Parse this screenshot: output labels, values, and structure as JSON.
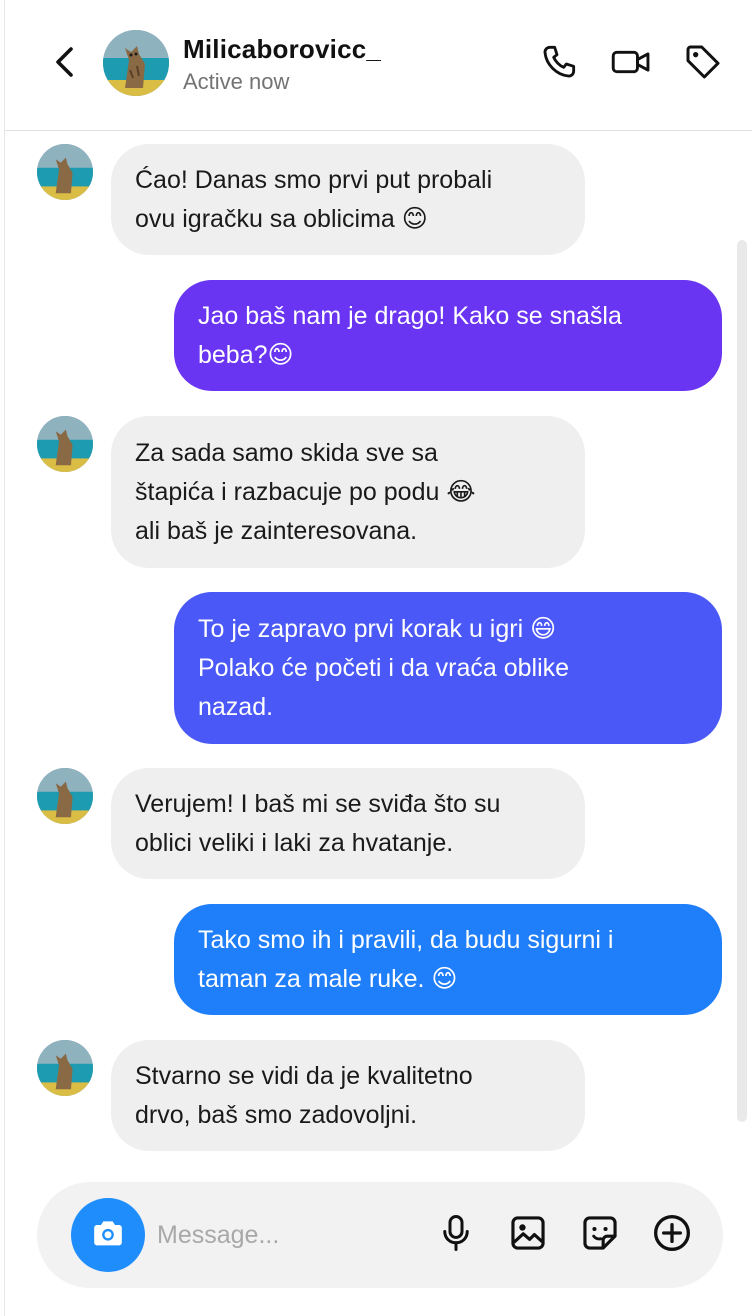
{
  "header": {
    "contact_name": "Milicaborovicc_",
    "status": "Active now"
  },
  "icons": {
    "back": "chevron-left-icon",
    "call": "phone-icon",
    "video": "video-camera-icon",
    "tag": "tag-icon",
    "camera": "camera-icon",
    "mic": "microphone-icon",
    "gallery": "image-icon",
    "sticker": "sticker-icon",
    "add": "plus-circle-icon"
  },
  "colors": {
    "incoming_bubble": "#efefef",
    "outgoing_1": "#6a35f2",
    "outgoing_2": "#4a58f7",
    "outgoing_3": "#1f7ef9",
    "camera_button": "#1f8efc"
  },
  "messages": [
    {
      "direction": "incoming",
      "lines": [
        "Ćao! Danas smo prvi put probali",
        "ovu igračku sa oblicima 😊"
      ]
    },
    {
      "direction": "outgoing",
      "lines": [
        "Jao baš nam je drago! Kako se snašla",
        "beba?😊"
      ]
    },
    {
      "direction": "incoming",
      "lines": [
        "Za sada samo skida sve sa",
        "štapića i razbacuje po podu 😂",
        "ali baš je zainteresovana."
      ]
    },
    {
      "direction": "outgoing",
      "lines": [
        "To je zapravo prvi korak u igri 😄",
        "Polako će početi i da vraća oblike",
        "nazad."
      ]
    },
    {
      "direction": "incoming",
      "lines": [
        "Verujem! I baš mi se sviđa što su",
        "oblici veliki i laki za hvatanje."
      ]
    },
    {
      "direction": "outgoing",
      "lines": [
        "Tako smo ih i pravili, da budu sigurni i",
        "taman za male ruke. 😊"
      ]
    },
    {
      "direction": "incoming",
      "lines": [
        "Stvarno se vidi da je kvalitetno",
        "drvo, baš smo zadovoljni."
      ]
    }
  ],
  "composer": {
    "placeholder": "Message...",
    "value": ""
  }
}
